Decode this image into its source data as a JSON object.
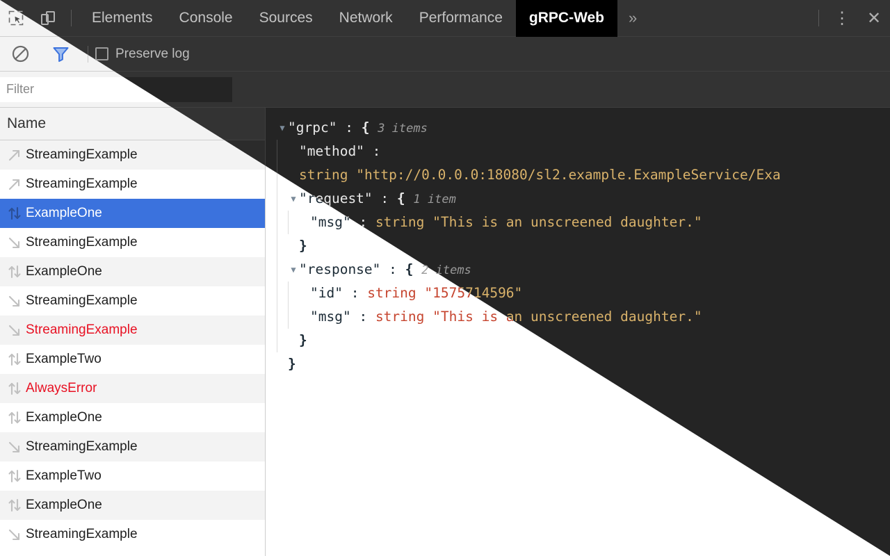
{
  "window": {
    "title": "Chrome DevTools — gRPC-Web panel"
  },
  "toolbar": {
    "inspect_icon": "inspect-element-icon",
    "device_icon": "device-toolbar-icon",
    "tabs": [
      {
        "label": "Elements",
        "active": false
      },
      {
        "label": "Console",
        "active": false
      },
      {
        "label": "Sources",
        "active": false
      },
      {
        "label": "Network",
        "active": false
      },
      {
        "label": "Performance",
        "active": false
      },
      {
        "label": "gRPC-Web",
        "active": true
      }
    ],
    "more_tabs_label": "»",
    "menu_label": "⋮",
    "close_label": "✕"
  },
  "controls": {
    "clear_icon": "clear-log-icon",
    "filter_icon": "filter-icon",
    "preserve_log_label": "Preserve log",
    "preserve_log_checked": false
  },
  "filter": {
    "value": "",
    "placeholder": "Filter"
  },
  "list": {
    "column_header": "Name",
    "rows": [
      {
        "name": "StreamingExample",
        "icon": "arrow-up-right-icon",
        "error": false,
        "selected": false
      },
      {
        "name": "StreamingExample",
        "icon": "arrow-up-right-icon",
        "error": false,
        "selected": false
      },
      {
        "name": "ExampleOne",
        "icon": "arrow-bidirectional-icon",
        "error": false,
        "selected": true
      },
      {
        "name": "StreamingExample",
        "icon": "arrow-down-right-icon",
        "error": false,
        "selected": false
      },
      {
        "name": "ExampleOne",
        "icon": "arrow-bidirectional-icon",
        "error": false,
        "selected": false
      },
      {
        "name": "StreamingExample",
        "icon": "arrow-down-right-icon",
        "error": false,
        "selected": false
      },
      {
        "name": "StreamingExample",
        "icon": "arrow-down-right-icon",
        "error": true,
        "selected": false
      },
      {
        "name": "ExampleTwo",
        "icon": "arrow-bidirectional-icon",
        "error": false,
        "selected": false
      },
      {
        "name": "AlwaysError",
        "icon": "arrow-bidirectional-icon",
        "error": true,
        "selected": false
      },
      {
        "name": "ExampleOne",
        "icon": "arrow-bidirectional-icon",
        "error": false,
        "selected": false
      },
      {
        "name": "StreamingExample",
        "icon": "arrow-down-right-icon",
        "error": false,
        "selected": false
      },
      {
        "name": "ExampleTwo",
        "icon": "arrow-bidirectional-icon",
        "error": false,
        "selected": false
      },
      {
        "name": "ExampleOne",
        "icon": "arrow-bidirectional-icon",
        "error": false,
        "selected": false
      },
      {
        "name": "StreamingExample",
        "icon": "arrow-down-right-icon",
        "error": false,
        "selected": false
      }
    ]
  },
  "detail": {
    "root_key": "\"grpc\"",
    "root_colon": " : ",
    "root_open": "{",
    "root_count": "3 items",
    "method_key": "\"method\"",
    "method_colon": " :",
    "method_type": "string",
    "method_value": "\"http://0.0.0.0:18080/sl2.example.ExampleService/Exa",
    "request_key": "\"request\"",
    "request_colon": " : ",
    "request_open": "{",
    "request_count": "1 item",
    "request_msg_key": "\"msg\"",
    "request_msg_colon": " : ",
    "request_msg_type": "string",
    "request_msg_value": "\"This is an unscreened daughter.\"",
    "request_close": "}",
    "response_key": "\"response\"",
    "response_colon": " : ",
    "response_open": "{",
    "response_count": "2 items",
    "response_id_key": "\"id\"",
    "response_id_colon": " : ",
    "response_id_type": "string",
    "response_id_value": "\"1575714596\"",
    "response_msg_key": "\"msg\"",
    "response_msg_colon": " : ",
    "response_msg_type": "string",
    "response_msg_value": "\"This is an unscreened daughter.\"",
    "response_close": "}",
    "root_close": "}",
    "expander": "▼"
  },
  "colors": {
    "selection_blue": "#3b72dd",
    "error_red": "#e81123",
    "dark_bg": "#242424",
    "dark_chrome": "#333333",
    "light_bg": "#ffffff",
    "light_chrome": "#f3f3f3",
    "string_dark": "#d9b26a",
    "string_light": "#c6452f",
    "filter_blue": "#4a7fe0"
  }
}
